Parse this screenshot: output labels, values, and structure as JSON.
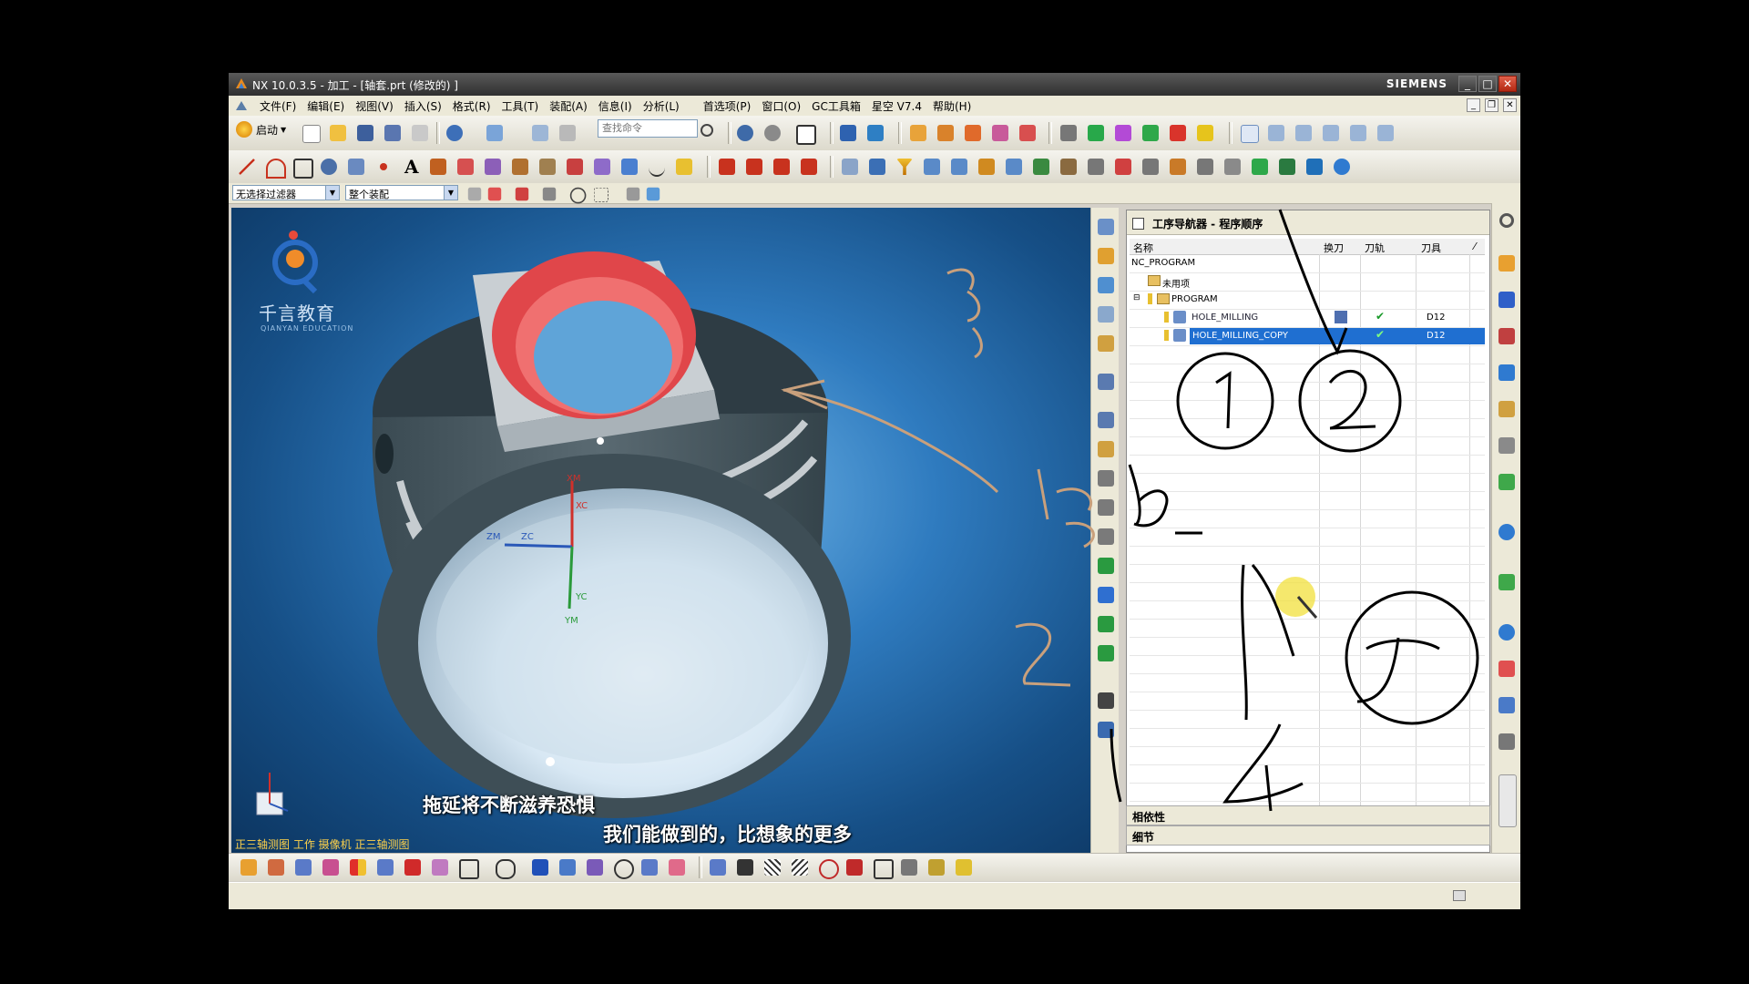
{
  "window": {
    "title": "NX 10.0.3.5 - 加工 - [轴套.prt  (修改的) ]",
    "brand": "SIEMENS",
    "minimize": "_",
    "maximize": "□",
    "close": "✕"
  },
  "menu": [
    "文件(F)",
    "编辑(E)",
    "视图(V)",
    "插入(S)",
    "格式(R)",
    "工具(T)",
    "装配(A)",
    "信息(I)",
    "分析(L)",
    "首选项(P)",
    "窗口(O)",
    "GC工具箱",
    "星空 V7.4",
    "帮助(H)"
  ],
  "toolbar": {
    "start_label": "启动",
    "search_placeholder": "查找命令"
  },
  "filter": {
    "selection_filter": "无选择过滤器",
    "assembly_scope": "整个装配"
  },
  "viewport": {
    "logo_text": "千言教育",
    "logo_sub": "QIANYAN EDUCATION",
    "axis_labels": {
      "xm": "XM",
      "xc": "XC",
      "zm": "ZM",
      "zc": "ZC",
      "yc": "YC",
      "ym": "YM"
    },
    "subtitle_1": "拖延将不断滋养恐惧",
    "subtitle_2": "我们能做到的，比想象的更多",
    "view_status": "正三轴测图  工作  摄像机  正三轴测图"
  },
  "navigator": {
    "title": "工序导航器 - 程序顺序",
    "columns": [
      "名称",
      "换刀",
      "刀轨",
      "刀具"
    ],
    "rows": [
      {
        "name": "NC_PROGRAM",
        "indent": 0,
        "tool": "",
        "selected": false
      },
      {
        "name": "未用项",
        "indent": 1,
        "tool": "",
        "selected": false
      },
      {
        "name": "PROGRAM",
        "indent": 1,
        "tool": "",
        "selected": false
      },
      {
        "name": "HOLE_MILLING",
        "indent": 2,
        "tool": "D12",
        "selected": false,
        "check": "✔"
      },
      {
        "name": "HOLE_MILLING_COPY",
        "indent": 2,
        "tool": "D12",
        "selected": true,
        "check": "✔"
      }
    ],
    "panel_dependencies": "相依性",
    "panel_details": "细节"
  },
  "accent_colors": {
    "selection": "#1f6fd1",
    "ink": "#000000",
    "ink_orange": "#c9a07c",
    "highlight": "#f2e03c"
  }
}
